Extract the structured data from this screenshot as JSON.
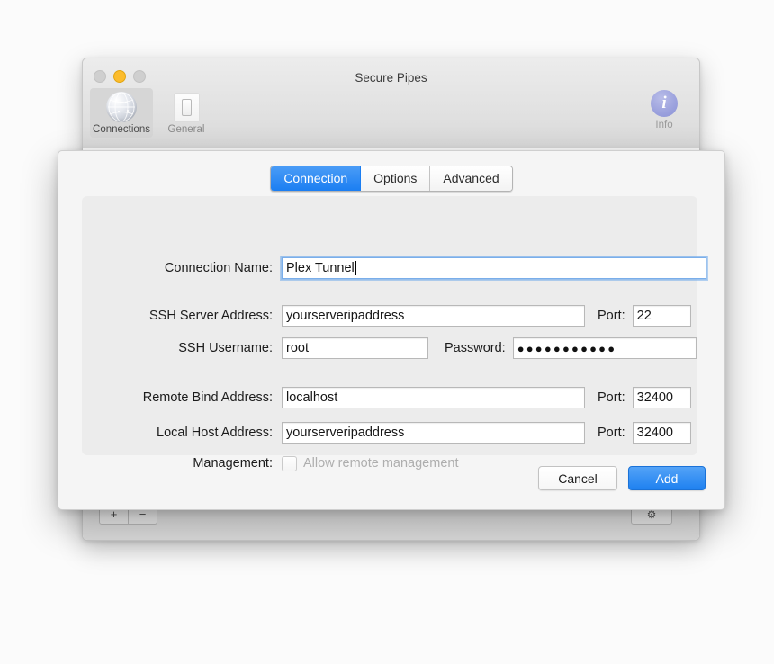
{
  "window": {
    "title": "Secure Pipes",
    "traffic_lights": [
      "close",
      "minimize",
      "zoom"
    ],
    "toolbar": [
      {
        "label": "Connections",
        "icon": "globe-icon",
        "selected": true
      },
      {
        "label": "General",
        "icon": "switch-icon",
        "selected": false
      }
    ],
    "info": {
      "label": "Info",
      "glyph": "i"
    },
    "bottom_bar": {
      "add_label": "+",
      "remove_label": "−",
      "action_label": "⚙"
    }
  },
  "dialog": {
    "tabs": [
      {
        "label": "Connection",
        "active": true
      },
      {
        "label": "Options",
        "active": false
      },
      {
        "label": "Advanced",
        "active": false
      }
    ],
    "fields": {
      "connection_name": {
        "label": "Connection Name:",
        "value": "Plex Tunnel",
        "focused": true
      },
      "ssh_server_address": {
        "label": "SSH Server Address:",
        "value": "yourserveripaddress"
      },
      "ssh_server_port": {
        "label": "Port:",
        "value": "22"
      },
      "ssh_username": {
        "label": "SSH Username:",
        "value": "root"
      },
      "password": {
        "label": "Password:",
        "value": "●●●●●●●●●●●"
      },
      "remote_bind_address": {
        "label": "Remote Bind Address:",
        "value": "localhost"
      },
      "remote_bind_port": {
        "label": "Port:",
        "value": "32400"
      },
      "local_host_address": {
        "label": "Local Host Address:",
        "value": "yourserveripaddress"
      },
      "local_host_port": {
        "label": "Port:",
        "value": "32400"
      },
      "management": {
        "label": "Management:",
        "checkbox_label": "Allow remote management",
        "checked": false,
        "disabled": true
      }
    },
    "buttons": {
      "cancel": "Cancel",
      "add": "Add"
    }
  },
  "colors": {
    "accent_blue": "#1e81f0",
    "tab_active": "#2b86f3",
    "focus_ring": "#7daee8",
    "window_chrome": "#e4e4e4",
    "panel": "#ececec",
    "minimize_yellow": "#fcbc2c",
    "disabled_text": "#aeaeae"
  }
}
